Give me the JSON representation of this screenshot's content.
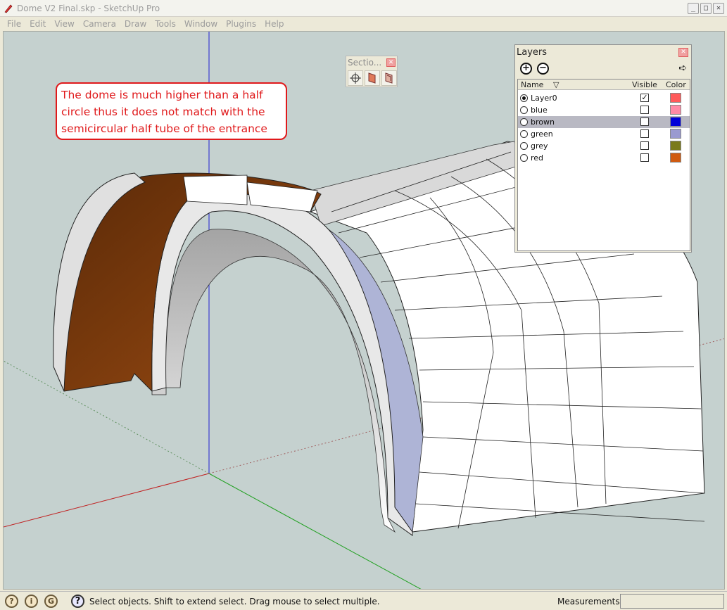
{
  "window": {
    "title": "Dome V2 Final.skp - SketchUp Pro",
    "minimize_icon": "minimize-icon",
    "maximize_icon": "maximize-icon",
    "close_icon": "close-icon",
    "min_glyph": "_",
    "max_glyph": "□",
    "close_glyph": "✕"
  },
  "menu": [
    "File",
    "Edit",
    "View",
    "Camera",
    "Draw",
    "Tools",
    "Window",
    "Plugins",
    "Help"
  ],
  "annotation": {
    "text_line1": "The dome is much higher than a half",
    "text_line2": "circle thus it does not match with the",
    "text_line3": "semicircular half tube of the entrance",
    "color": "#e0191b"
  },
  "section_palette": {
    "title": "Sectio...",
    "close_glyph": "✕",
    "tools": [
      "section-plane-icon",
      "display-section-planes-icon",
      "display-section-cuts-icon"
    ]
  },
  "layers_panel": {
    "title": "Layers",
    "close_glyph": "✕",
    "add_glyph": "+",
    "remove_glyph": "−",
    "details_glyph": "➪",
    "columns": {
      "name": "Name",
      "visible": "Visible",
      "color": "Color"
    },
    "sort_glyph": "▽",
    "rows": [
      {
        "name": "Layer0",
        "current": true,
        "visible": true,
        "color": "#ff5a5a",
        "selected": false
      },
      {
        "name": "blue",
        "current": false,
        "visible": false,
        "color": "#ff8aa6",
        "selected": false
      },
      {
        "name": "brown",
        "current": false,
        "visible": false,
        "color": "#0000d8",
        "selected": true
      },
      {
        "name": "green",
        "current": false,
        "visible": false,
        "color": "#9a9ad0",
        "selected": false
      },
      {
        "name": "grey",
        "current": false,
        "visible": false,
        "color": "#7a7a1a",
        "selected": false
      },
      {
        "name": "red",
        "current": false,
        "visible": false,
        "color": "#d05a10",
        "selected": false
      }
    ]
  },
  "status": {
    "icons": [
      "geo-location-icon",
      "credits-icon",
      "google-account-icon"
    ],
    "icon_glyphs": [
      "?",
      "i",
      "G"
    ],
    "help_glyph": "?",
    "message": "Select objects. Shift to extend select. Drag mouse to select multiple.",
    "measurements_label": "Measurements",
    "measurements_value": ""
  }
}
